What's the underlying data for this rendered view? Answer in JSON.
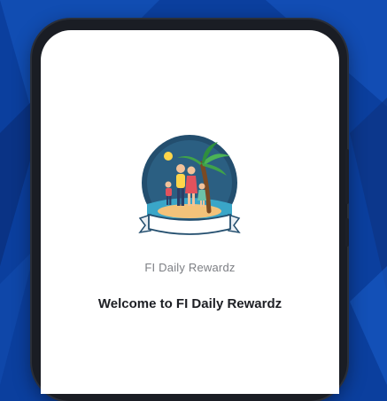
{
  "colors": {
    "background": "#0b3f9e",
    "screen": "#ffffff",
    "logo_circle": "#234e6e",
    "app_name_text": "#7d7f84",
    "welcome_text": "#1d1f24"
  },
  "logo": {
    "icon": "family-island-logo-icon"
  },
  "app_name": "FI Daily Rewardz",
  "welcome_text": "Welcome to FI Daily Rewardz"
}
